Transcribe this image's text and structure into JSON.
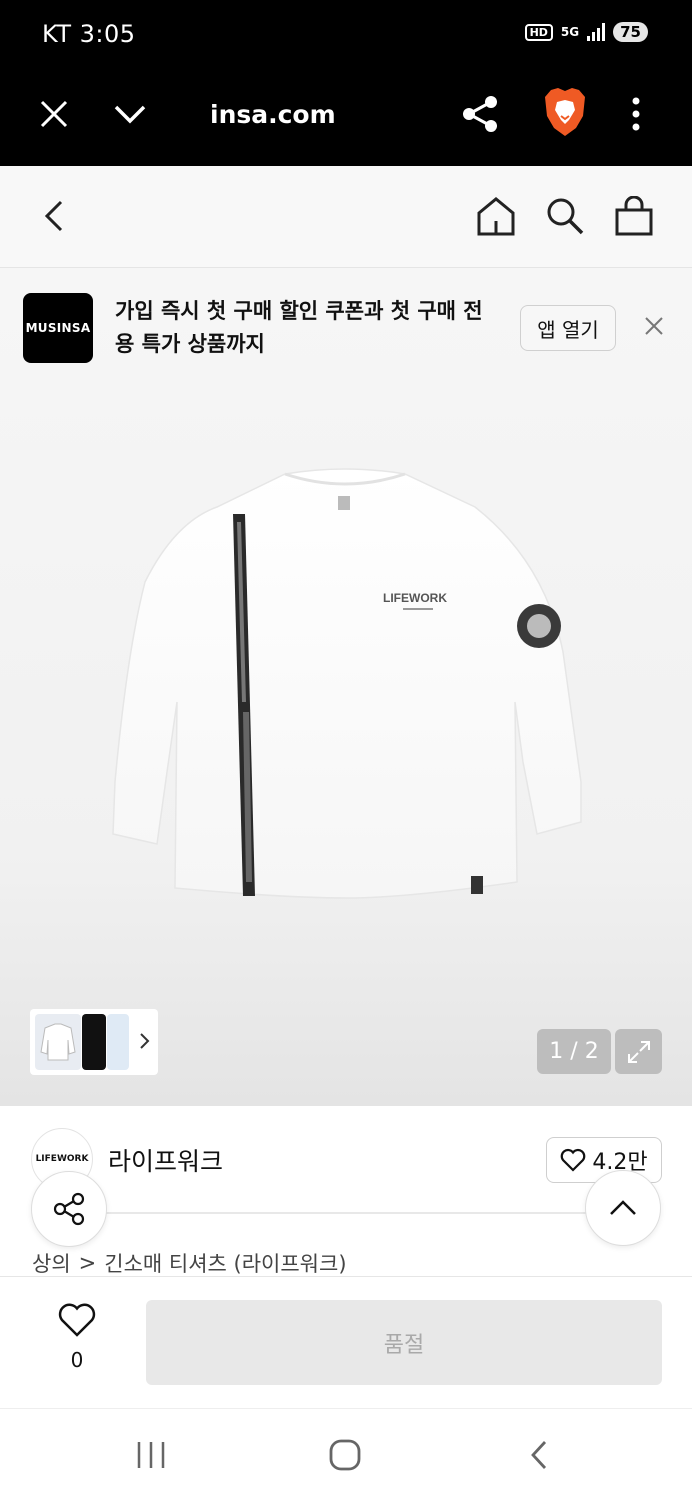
{
  "status": {
    "carrier_time": "KT 3:05",
    "hd": "HD",
    "net": "5G",
    "battery": "75"
  },
  "browser": {
    "url": "insa.com"
  },
  "promo": {
    "logo_text": "MUSINSA",
    "message": "가입 즉시 첫 구매 할인 쿠폰과 첫 구매 전용 특가 상품까지",
    "open_label": "앱 열기"
  },
  "gallery": {
    "counter": "1 / 2"
  },
  "brand": {
    "logo_text": "LIFEWORK",
    "name": "라이프워크",
    "likes": "4.2만"
  },
  "breadcrumb": {
    "category": "상의",
    "separator": ">",
    "subcategory": "긴소매 티셔츠 (라이프워크)"
  },
  "action": {
    "wish_count": "0",
    "buy_label": "품절"
  },
  "colors": {
    "header_bg": "#000000",
    "soldout_bg": "#e8e8e8",
    "counter_bg": "#bdbdbd",
    "brave": "#ef5a24"
  }
}
